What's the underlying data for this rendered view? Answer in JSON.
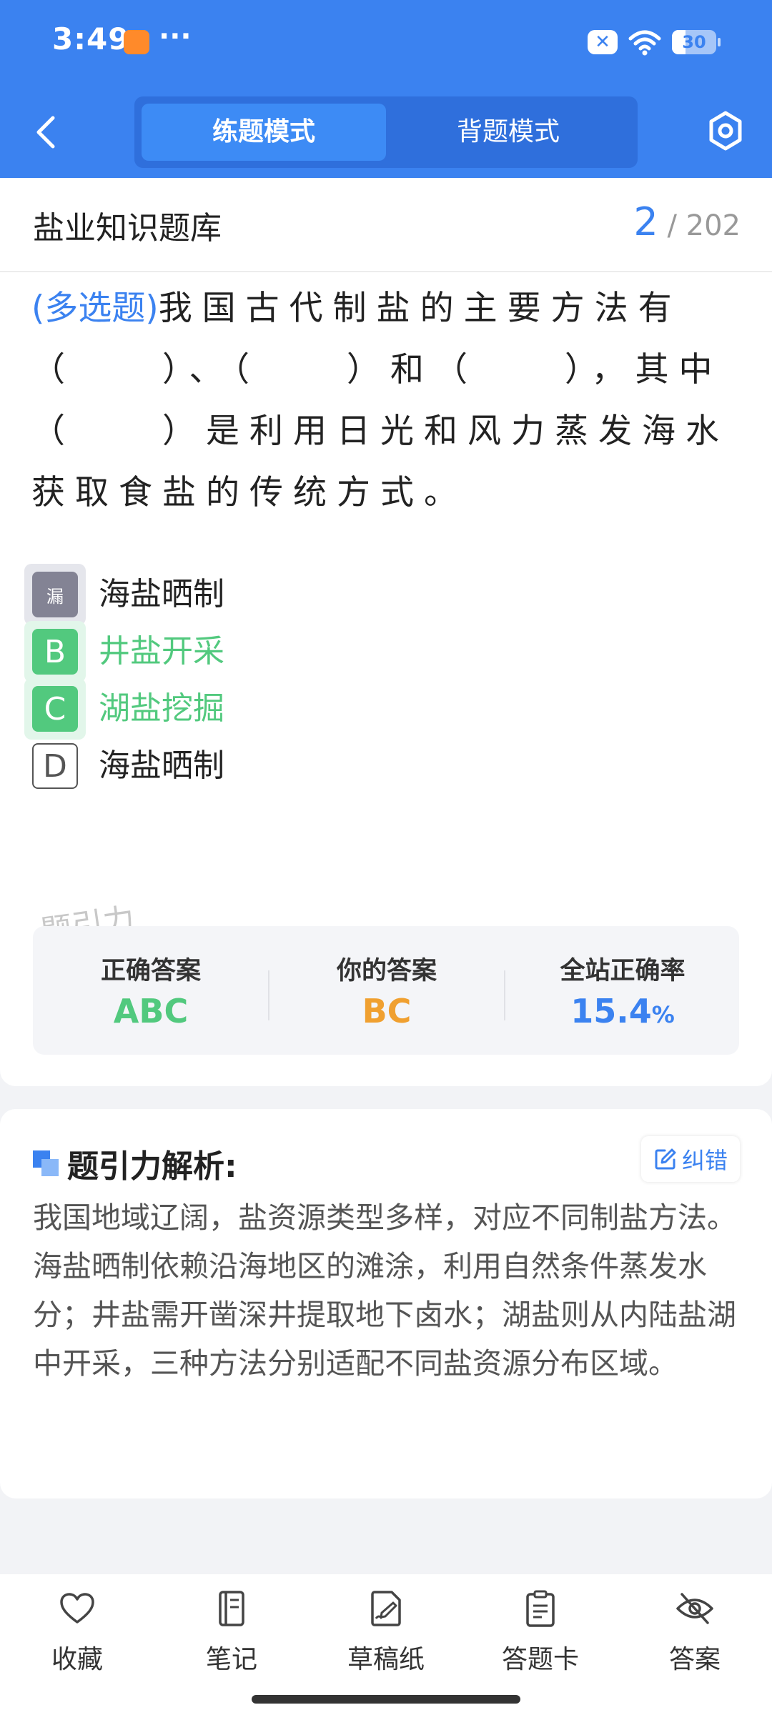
{
  "status_bar": {
    "time": "3:49",
    "dots": "···",
    "battery": "30",
    "battery_level": 0.3
  },
  "header": {
    "tabs": [
      {
        "label": "练题模式",
        "active": true
      },
      {
        "label": "背题模式",
        "active": false
      }
    ]
  },
  "question_card": {
    "bank_title": "盐业知识题库",
    "current": "2",
    "total": "/ 202",
    "type_label": "(多选题)",
    "text": "我国古代制盐的主要方法有（　　）、（　　）和（　　），其中（　　）是利用日光和风力蒸发海水获取食盐的传统方式。",
    "options": [
      {
        "marker": "漏",
        "text": "海盐晒制",
        "state": "missed"
      },
      {
        "marker": "B",
        "text": "井盐开采",
        "state": "correct"
      },
      {
        "marker": "C",
        "text": "湖盐挖掘",
        "state": "correct"
      },
      {
        "marker": "D",
        "text": "海盐晒制",
        "state": "plain"
      }
    ],
    "watermark": "题引力",
    "stats": {
      "correct_label": "正确答案",
      "correct_value": "ABC",
      "yours_label": "你的答案",
      "yours_value": "BC",
      "rate_label": "全站正确率",
      "rate_value": "15.4",
      "rate_unit": "%"
    }
  },
  "analysis": {
    "title": "题引力解析:",
    "correction_label": "纠错",
    "text": "我国地域辽阔，盐资源类型多样，对应不同制盐方法。海盐晒制依赖沿海地区的滩涂，利用自然条件蒸发水分；井盐需开凿深井提取地下卤水；湖盐则从内陆盐湖中开采，三种方法分别适配不同盐资源分布区域。"
  },
  "bottom_nav": [
    {
      "label": "收藏",
      "icon": "heart-icon"
    },
    {
      "label": "笔记",
      "icon": "notebook-icon"
    },
    {
      "label": "草稿纸",
      "icon": "draft-icon"
    },
    {
      "label": "答题卡",
      "icon": "clipboard-icon"
    },
    {
      "label": "答案",
      "icon": "eye-off-icon"
    }
  ],
  "colors": {
    "primary": "#3b82f0",
    "correct_green": "#52c97e",
    "your_answer_orange": "#f0a030",
    "missed_gray": "#838394"
  }
}
